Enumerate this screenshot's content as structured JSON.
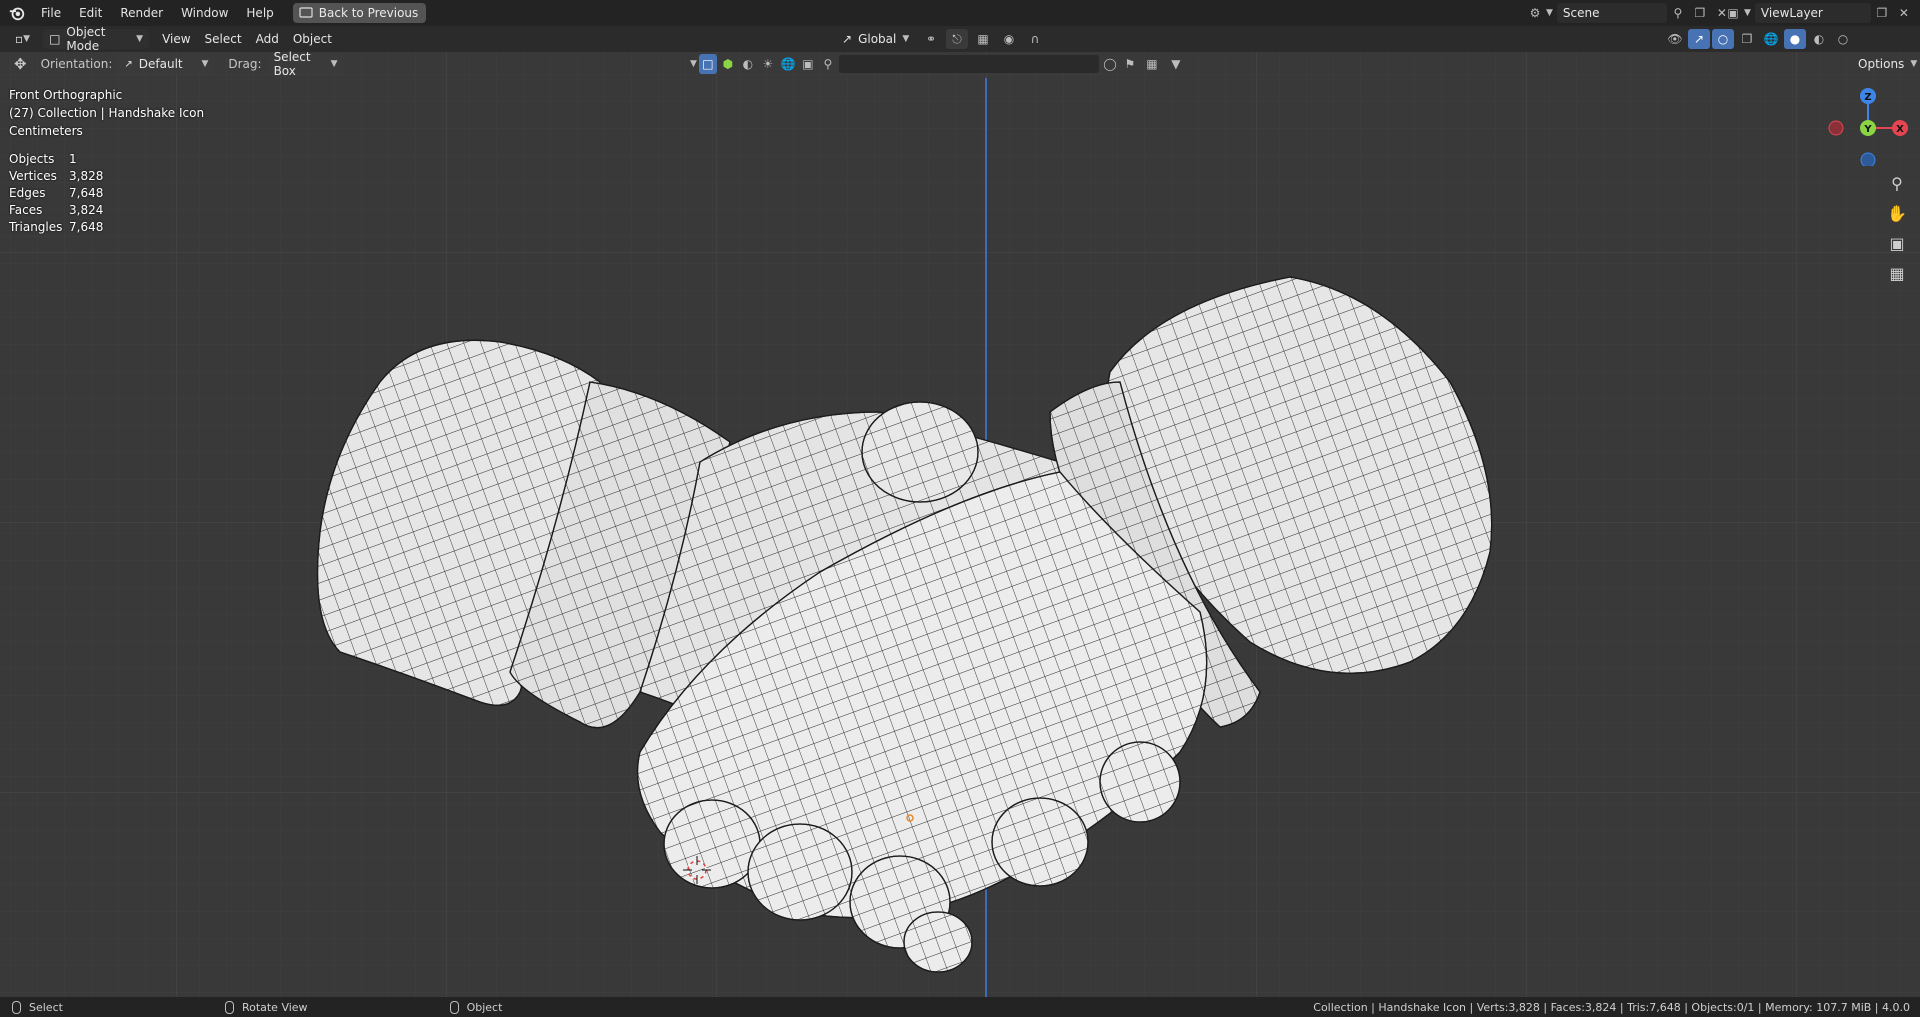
{
  "menu": {
    "items": [
      "File",
      "Edit",
      "Render",
      "Window",
      "Help"
    ],
    "back_button": "Back to Previous"
  },
  "scene": {
    "label": "Scene",
    "view_layer": "ViewLayer"
  },
  "header": {
    "mode": "Object Mode",
    "menus": [
      "View",
      "Select",
      "Add",
      "Object"
    ],
    "transform_orientation": "Global"
  },
  "toolbar": {
    "orientation_label": "Orientation:",
    "orientation_value": "Default",
    "drag_label": "Drag:",
    "drag_value": "Select Box",
    "options": "Options"
  },
  "viewport": {
    "view_name": "Front Orthographic",
    "collection": "(27) Collection | Handshake Icon",
    "units": "Centimeters"
  },
  "stats": [
    {
      "label": "Objects",
      "value": "1"
    },
    {
      "label": "Vertices",
      "value": "3,828"
    },
    {
      "label": "Edges",
      "value": "7,648"
    },
    {
      "label": "Faces",
      "value": "3,824"
    },
    {
      "label": "Triangles",
      "value": "7,648"
    }
  ],
  "gizmo": {
    "z": "Z",
    "y": "Y",
    "x": "X"
  },
  "statusbar": {
    "left": [
      "Select",
      "Rotate View",
      "Object"
    ],
    "right": "Collection | Handshake Icon | Verts:3,828 | Faces:3,824 | Tris:7,648 | Objects:0/1 | Memory: 107.7 MiB | 4.0.0"
  },
  "colors": {
    "accent_blue": "#4772b3",
    "axis_x": "#e44552",
    "axis_y": "#8bd444",
    "axis_z": "#3d85e8",
    "viewport_bg": "#393939"
  }
}
